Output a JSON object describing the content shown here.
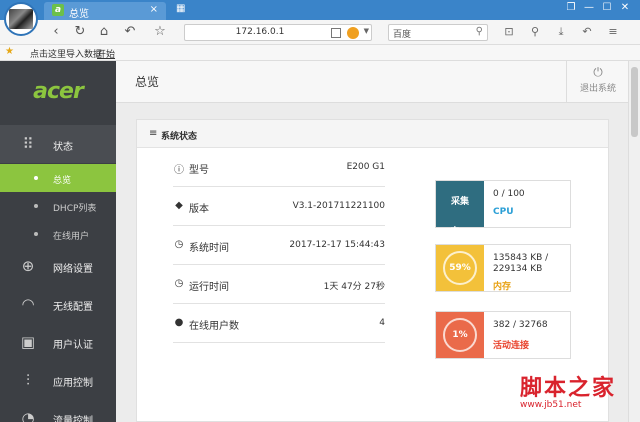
{
  "browser": {
    "tab_title": "总览",
    "tab_badge": "a",
    "tab_close": "×",
    "grid_icon": "▦",
    "window_controls": [
      "❐",
      "—",
      "☐",
      "✕"
    ],
    "address": "172.16.0.1",
    "search_placeholder": "百度",
    "bookmarks": {
      "import": "点击这里导入数据",
      "start": "开始"
    }
  },
  "sidebar": {
    "logo": "acer",
    "nav": [
      {
        "label": "状态",
        "icon": "grid-dots-icon"
      },
      {
        "label": "网络设置",
        "icon": "globe-icon"
      },
      {
        "label": "无线配置",
        "icon": "wifi-icon"
      },
      {
        "label": "用户认证",
        "icon": "id-card-icon"
      },
      {
        "label": "应用控制",
        "icon": "sliders-icon"
      },
      {
        "label": "流量控制",
        "icon": "gauge-icon"
      }
    ],
    "sub": [
      {
        "label": "总览",
        "active": true
      },
      {
        "label": "DHCP列表",
        "active": false
      },
      {
        "label": "在线用户",
        "active": false
      }
    ]
  },
  "main": {
    "title": "总览",
    "logout": "退出系统",
    "panel_title": "系统状态",
    "info": [
      {
        "key": "型号",
        "value": "E200 G1",
        "icon": "info-icon"
      },
      {
        "key": "版本",
        "value": "V3.1-201711221100",
        "icon": "tag-icon"
      },
      {
        "key": "系统时间",
        "value": "2017-12-17 15:44:43",
        "icon": "clock-icon"
      },
      {
        "key": "运行时间",
        "value": "1天 47分 27秒",
        "icon": "clock-icon"
      },
      {
        "key": "在线用户数",
        "value": "4",
        "icon": "user-icon"
      }
    ],
    "stats": [
      {
        "badge": "采集中...",
        "value": "0 / 100",
        "name": "CPU",
        "color": "#2f6d80",
        "name_color": "#2b9fd6"
      },
      {
        "badge": "59%",
        "value": "135843 KB /\n229134 KB",
        "name": "内存",
        "color": "#f3c13a",
        "name_color": "#e8a317"
      },
      {
        "badge": "1%",
        "value": "382 / 32768",
        "name": "活动连接",
        "color": "#ea6a4a",
        "name_color": "#e8402a"
      }
    ]
  },
  "watermark": {
    "big": "脚本之家",
    "small": "www.jb51.net"
  }
}
